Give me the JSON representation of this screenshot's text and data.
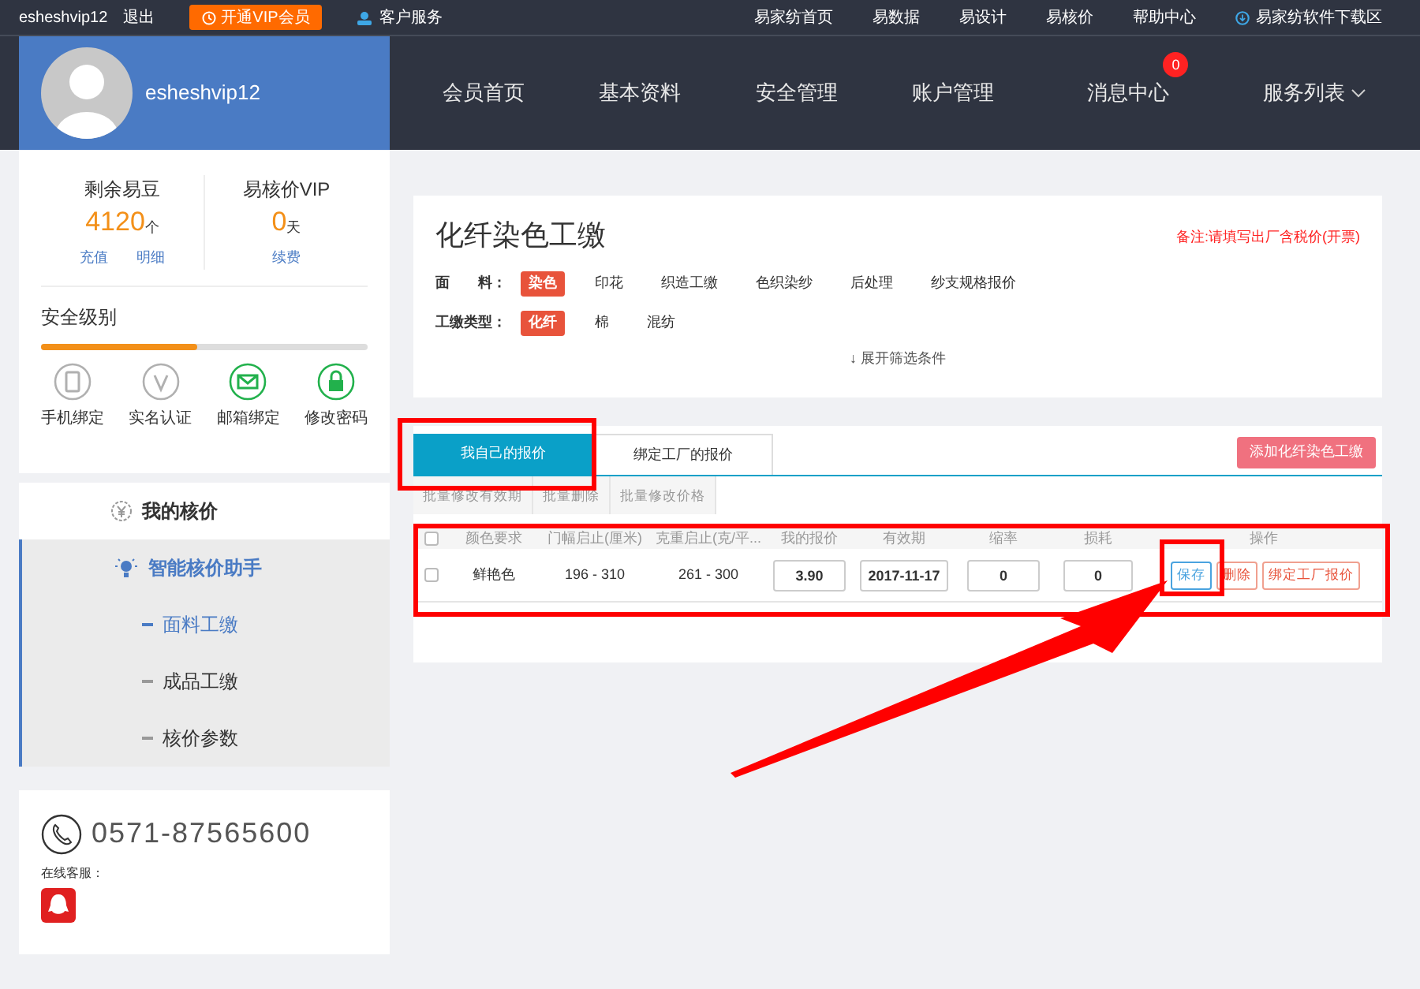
{
  "top_bar": {
    "username": "esheshvip12",
    "logout": "退出",
    "vip_button": "开通VIP会员",
    "service": "客户服务",
    "links": [
      {
        "label": "易家纺首页"
      },
      {
        "label": "易数据"
      },
      {
        "label": "易设计"
      },
      {
        "label": "易核价"
      },
      {
        "label": "帮助中心"
      },
      {
        "label": "易家纺软件下载区",
        "kind": "download"
      }
    ]
  },
  "profile": {
    "name": "esheshvip12"
  },
  "nav": [
    {
      "label": "会员首页",
      "kind": "plain"
    },
    {
      "label": "基本资料",
      "kind": "plain"
    },
    {
      "label": "安全管理",
      "kind": "plain"
    },
    {
      "label": "账户管理",
      "kind": "plain"
    },
    {
      "label": "消息中心",
      "kind": "badge",
      "badge": "0"
    },
    {
      "label": "服务列表",
      "kind": "dropdown"
    }
  ],
  "stats": [
    {
      "title": "剩余易豆",
      "value": "4120",
      "unit": "个",
      "links": [
        "充值",
        "明细"
      ]
    },
    {
      "title": "易核价VIP",
      "value": "0",
      "unit": "天",
      "links": [
        "续费"
      ]
    }
  ],
  "security": {
    "title": "安全级别",
    "level": 0.48,
    "items": [
      {
        "label": "手机绑定",
        "kind": "phone",
        "bound": false
      },
      {
        "label": "实名认证",
        "kind": "verify",
        "bound": false
      },
      {
        "label": "邮箱绑定",
        "kind": "mail",
        "bound": true
      },
      {
        "label": "修改密码",
        "kind": "lock",
        "bound": true
      }
    ]
  },
  "menu": [
    {
      "label": "我的核价",
      "kind": "price",
      "expanded": false
    },
    {
      "label": "智能核价助手",
      "kind": "bulb",
      "expanded": true,
      "children": [
        {
          "label": "面料工缴",
          "selected": true
        },
        {
          "label": "成品工缴",
          "selected": false
        },
        {
          "label": "核价参数",
          "selected": false
        }
      ]
    }
  ],
  "contact": {
    "phone": "0571-87565600",
    "online_label": "在线客服："
  },
  "filter": {
    "title": "化纤染色工缴",
    "note": "备注:请填写出厂含税价(开票)",
    "expand": "↓ 展开筛选条件",
    "groups": [
      {
        "label": "面　　料：",
        "options": [
          {
            "label": "染色",
            "selected": true
          },
          {
            "label": "印花",
            "selected": false
          },
          {
            "label": "织造工缴",
            "selected": false
          },
          {
            "label": "色织染纱",
            "selected": false
          },
          {
            "label": "后处理",
            "selected": false
          },
          {
            "label": "纱支规格报价",
            "selected": false
          }
        ]
      },
      {
        "label": "工缴类型：",
        "options": [
          {
            "label": "化纤",
            "selected": true
          },
          {
            "label": "棉",
            "selected": false
          },
          {
            "label": "混纺",
            "selected": false
          }
        ]
      }
    ]
  },
  "tabs": [
    {
      "label": "我自己的报价",
      "selected": true
    },
    {
      "label": "绑定工厂的报价",
      "selected": false
    }
  ],
  "add_button": "添加化纤染色工缴",
  "batch_actions": [
    "批量修改有效期",
    "批量删除",
    "批量修改价格"
  ],
  "table": {
    "all_checked": false,
    "columns": [
      "颜色要求",
      "门幅启止(厘米)",
      "克重启止(克/平...",
      "我的报价",
      "有效期",
      "缩率",
      "损耗",
      "操作"
    ],
    "rows": [
      {
        "checked": false,
        "color_req": "鲜艳色",
        "width": "196 - 310",
        "weight": "261 - 300",
        "price": "3.90",
        "valid": "2017-11-17",
        "shrink": "0",
        "loss": "0",
        "actions": [
          {
            "label": "保存",
            "kind": "save"
          },
          {
            "label": "删除",
            "kind": "danger"
          },
          {
            "label": "绑定工厂报价",
            "kind": "danger"
          }
        ]
      }
    ]
  }
}
